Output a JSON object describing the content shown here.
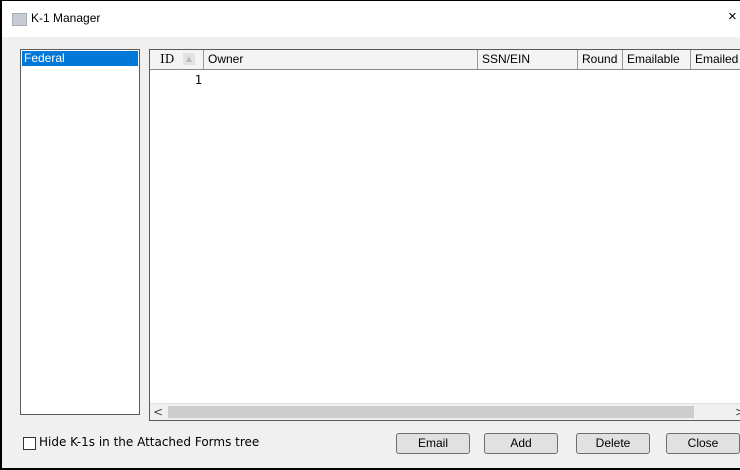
{
  "window": {
    "title": "K-1 Manager",
    "close_glyph": "×"
  },
  "tree": {
    "items": [
      {
        "label": "Federal",
        "selected": true
      }
    ]
  },
  "grid": {
    "columns": [
      "ID",
      "Owner",
      "SSN/EIN",
      "Round",
      "Emailable",
      "Emailed"
    ],
    "sort_column": "ID",
    "sort_indicator": "▲",
    "rows": [
      {
        "id": "1",
        "owner": "",
        "ssn": "",
        "round": "",
        "emailable": "",
        "emailed": ""
      }
    ]
  },
  "scrollbar": {
    "left_arrow": "<",
    "right_arrow": ">"
  },
  "options": {
    "hide_k1s_label": "Hide K-1s in the Attached Forms tree",
    "hide_k1s_checked": false
  },
  "buttons": {
    "email": "Email",
    "add": "Add",
    "delete": "Delete",
    "close": "Close"
  },
  "colors": {
    "selection": "#0078d7",
    "window_bg": "#f0f0f0"
  }
}
